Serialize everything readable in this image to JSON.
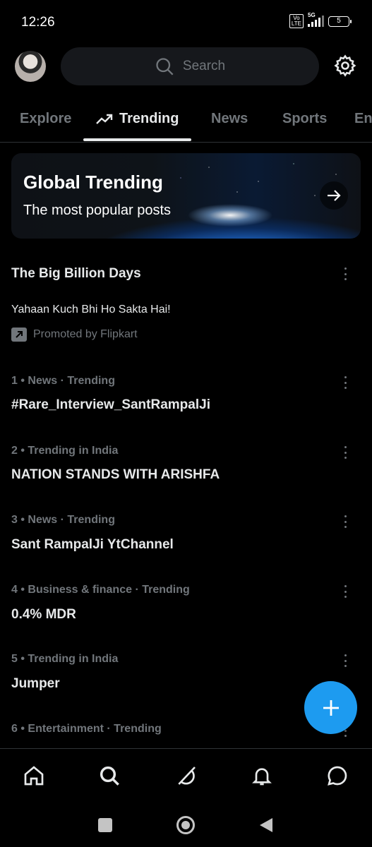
{
  "status_bar": {
    "time": "12:26",
    "network": "5G",
    "volte": "Vo LTE",
    "battery": "5"
  },
  "header": {
    "avatar_icon": "profile-avatar",
    "search_placeholder": "Search",
    "settings_icon": "gear-icon"
  },
  "tabs": [
    {
      "label": "Explore"
    },
    {
      "label": "Trending",
      "active": true
    },
    {
      "label": "News"
    },
    {
      "label": "Sports"
    },
    {
      "label": "Ent"
    }
  ],
  "banner": {
    "title": "Global Trending",
    "subtitle": "The most popular posts",
    "arrow_icon": "arrow-right-icon"
  },
  "promoted": {
    "title": "The Big Billion Days",
    "text": "Yahaan Kuch Bhi Ho Sakta Hai!",
    "by": "Promoted by Flipkart"
  },
  "trends": [
    {
      "meta": "1 • News · Trending",
      "name": "#Rare_Interview_SantRampalJi"
    },
    {
      "meta": "2 • Trending in India",
      "name": "NATION STANDS WITH ARISHFA"
    },
    {
      "meta": "3 • News · Trending",
      "name": "Sant RampalJi YtChannel"
    },
    {
      "meta": "4 • Business & finance · Trending",
      "name": "0.4% MDR"
    },
    {
      "meta": "5 • Trending in India",
      "name": "Jumper"
    },
    {
      "meta": "6 • Entertainment · Trending",
      "name": ""
    }
  ],
  "colors": {
    "background": "#000000",
    "accent": "#1d9bf0",
    "secondary_text": "#71767b",
    "primary_text": "#e7e9ea"
  },
  "bottom_nav": [
    "home-icon",
    "search-icon",
    "grok-icon",
    "notifications-icon",
    "messages-icon"
  ],
  "system_nav": [
    "recents-button",
    "home-button",
    "back-button"
  ]
}
